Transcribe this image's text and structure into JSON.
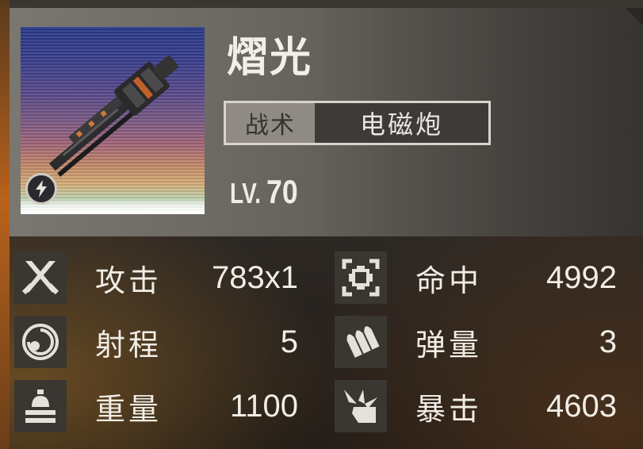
{
  "weapon": {
    "name": "熠光",
    "category": "战术",
    "type": "电磁炮",
    "level_prefix": "LV.",
    "level": "70"
  },
  "stats": [
    {
      "label": "攻击",
      "value": "783x1",
      "icon": "crossed-swords-icon"
    },
    {
      "label": "命中",
      "value": "4992",
      "icon": "crosshair-target-icon"
    },
    {
      "label": "射程",
      "value": "5",
      "icon": "range-circle-icon"
    },
    {
      "label": "弹量",
      "value": "3",
      "icon": "ammo-bullets-icon"
    },
    {
      "label": "重量",
      "value": "1100",
      "icon": "weight-icon"
    },
    {
      "label": "暴击",
      "value": "4603",
      "icon": "critical-burst-icon"
    }
  ],
  "colors": {
    "text": "#f1ede6",
    "icon_bg": "#3a3632",
    "tag_left_bg": "#8f8b84",
    "tag_right_bg": "#3d3b39"
  }
}
